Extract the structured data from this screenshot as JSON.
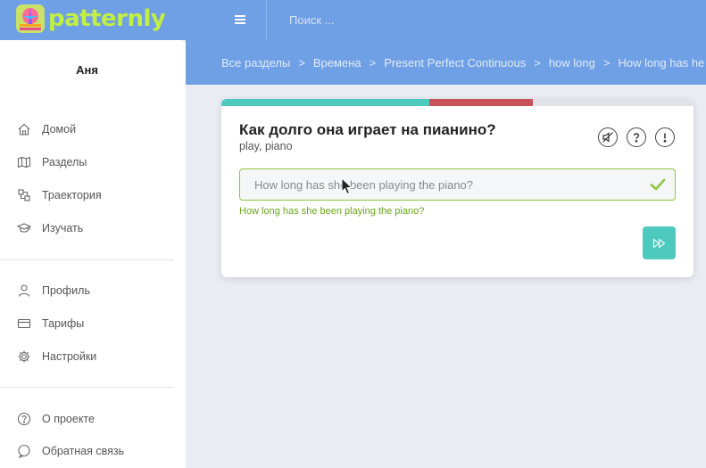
{
  "header": {
    "logo_text": "patternly",
    "search_placeholder": "Поиск ..."
  },
  "breadcrumbs": [
    {
      "label": "Все разделы"
    },
    {
      "label": "Времена"
    },
    {
      "label": "Present Perfect Continuous"
    },
    {
      "label": "how long"
    },
    {
      "label": "How long has he /"
    }
  ],
  "breadcrumb_separator": ">",
  "sidebar": {
    "user_name": "Аня",
    "items": [
      {
        "label": "Домой",
        "icon": "home-icon"
      },
      {
        "label": "Разделы",
        "icon": "map-icon"
      },
      {
        "label": "Траектория",
        "icon": "trajectory-icon"
      },
      {
        "label": "Изучать",
        "icon": "graduation-cap-icon"
      },
      {
        "label": "Профиль",
        "icon": "user-icon"
      },
      {
        "label": "Тарифы",
        "icon": "card-icon"
      },
      {
        "label": "Настройки",
        "icon": "gear-icon"
      },
      {
        "label": "О проекте",
        "icon": "question-icon"
      },
      {
        "label": "Обратная связь",
        "icon": "chat-icon"
      }
    ]
  },
  "exercise": {
    "question": "Как долго она играет на пианино?",
    "hint": "play, piano",
    "answer_value": "How long has she been playing the piano?",
    "correct_answer": "How long has she been playing the piano?",
    "progress": {
      "correct_fraction": 0.44,
      "wrong_fraction": 0.22
    }
  },
  "colors": {
    "header_bg": "#6f9fe4",
    "accent_teal": "#4ec9bd",
    "error_red": "#c9515a",
    "success_green": "#69a617"
  }
}
